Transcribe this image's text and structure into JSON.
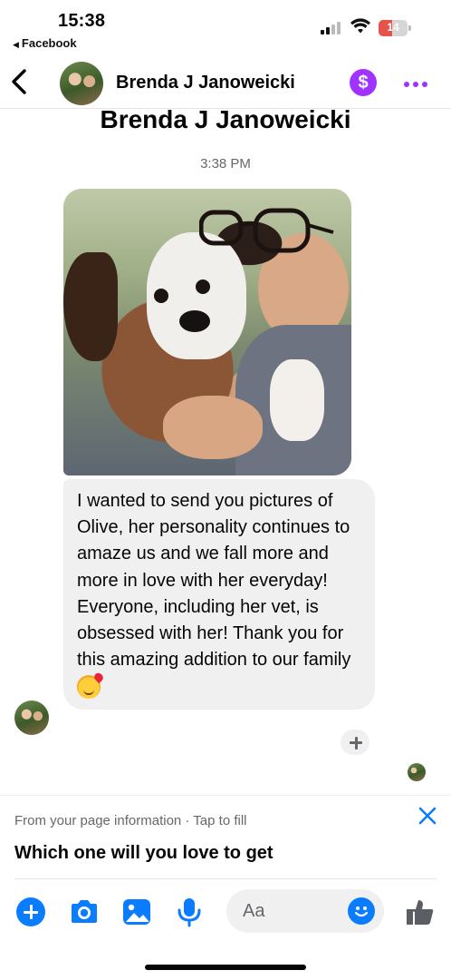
{
  "status_bar": {
    "time": "15:38",
    "back_app": "Facebook",
    "battery_level": "14",
    "icons": [
      "signal-icon",
      "wifi-icon",
      "battery-icon"
    ]
  },
  "header": {
    "contact_name": "Brenda J Janoweicki",
    "back_icon": "chevron-left-icon",
    "pay_icon": "dollar-icon",
    "pay_symbol": "$",
    "more_icon": "more-dots-icon",
    "accent_color": "#a033ff"
  },
  "thread": {
    "title": "Brenda J Janoweicki",
    "timestamp": "3:38 PM",
    "message": {
      "photo_icon": "photo-attachment",
      "text": "I wanted to send you pictures of Olive, her personality continues to amaze us and we fall more and more in love with her everyday! Everyone, including her vet, is obsessed with her! Thank you for this amazing addition to our family",
      "emoji": "smiling-face-with-hearts-emoji"
    },
    "reaction_icon": "add-reaction-icon"
  },
  "suggestion": {
    "hint": "From your page information · Tap to fill",
    "value": "Which one will you love to get",
    "close_icon": "close-icon"
  },
  "composer": {
    "placeholder": "Aa",
    "icons": [
      "plus-icon",
      "camera-icon",
      "gallery-icon",
      "microphone-icon",
      "emoji-icon",
      "like-icon"
    ],
    "accent_color": "#0a7cff"
  }
}
